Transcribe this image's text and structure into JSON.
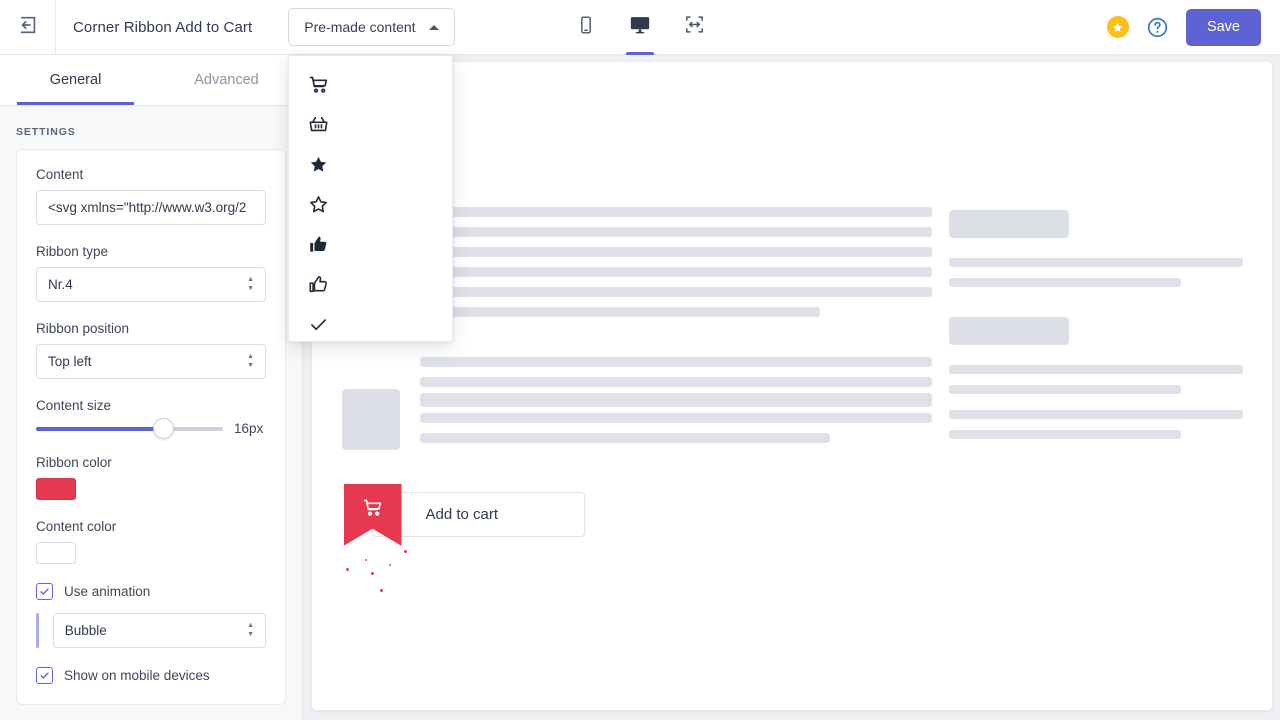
{
  "topbar": {
    "back_icon": "back-arrow-icon",
    "title": "Corner Ribbon Add to Cart",
    "premade_button": "Pre-made content",
    "premade_caret": "chevron-up-icon",
    "devices": [
      {
        "name": "mobile",
        "active": false
      },
      {
        "name": "desktop",
        "active": true
      },
      {
        "name": "responsive",
        "active": false
      }
    ],
    "star_icon": "star-badge-icon",
    "help_icon": "help-circle-icon",
    "save_label": "Save"
  },
  "premade_menu": {
    "items": [
      {
        "icon": "shopping-cart-icon"
      },
      {
        "icon": "shopping-basket-icon"
      },
      {
        "icon": "star-filled-icon"
      },
      {
        "icon": "star-outline-icon"
      },
      {
        "icon": "thumbs-up-filled-icon"
      },
      {
        "icon": "thumbs-up-outline-icon"
      },
      {
        "icon": "checkmark-icon"
      }
    ]
  },
  "tabs": [
    {
      "label": "General",
      "active": true
    },
    {
      "label": "Advanced",
      "active": false
    }
  ],
  "settings": {
    "section_label": "SETTINGS",
    "content": {
      "label": "Content",
      "value": "<svg xmlns=\"http://www.w3.org/2"
    },
    "ribbon_type": {
      "label": "Ribbon type",
      "value": "Nr.4"
    },
    "ribbon_position": {
      "label": "Ribbon position",
      "value": "Top left"
    },
    "content_size": {
      "label": "Content size",
      "value": "16px",
      "percent": 68
    },
    "ribbon_color": {
      "label": "Ribbon color",
      "value": "#e63950"
    },
    "content_color": {
      "label": "Content color",
      "value": "#ffffff"
    },
    "use_animation": {
      "label": "Use animation",
      "checked": true
    },
    "animation_type": {
      "value": "Bubble"
    },
    "show_mobile": {
      "label": "Show on mobile devices",
      "checked": true
    }
  },
  "preview": {
    "add_to_cart_label": "Add to cart",
    "ribbon_icon": "shopping-cart-icon"
  },
  "colors": {
    "accent": "#5b63d3",
    "ribbon_red": "#e63950",
    "star_yellow": "#fcbe18",
    "skeleton": "#dee2e8"
  }
}
